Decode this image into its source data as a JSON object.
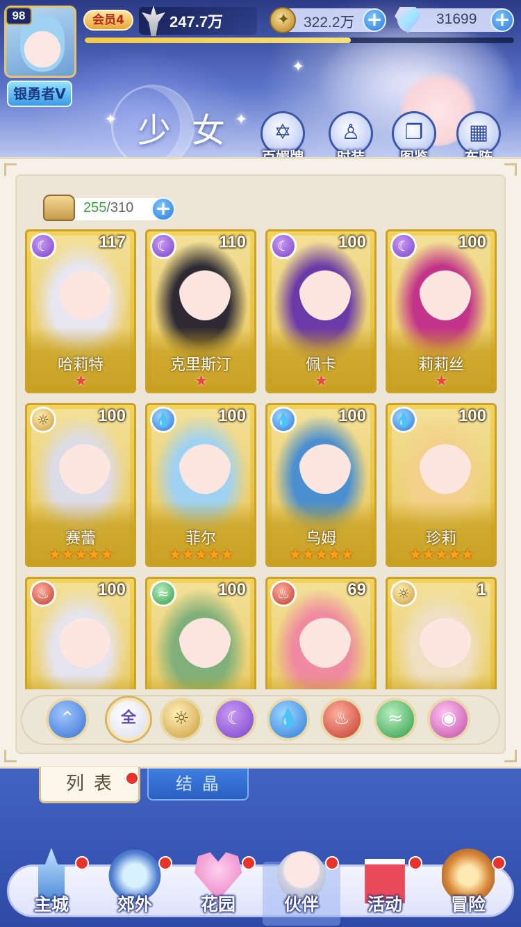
{
  "player": {
    "level": "98",
    "title": "银勇者V",
    "vip": "会员4",
    "power": "247.7万",
    "exp_progress": 0.62
  },
  "resources": [
    {
      "name": "gold-coin",
      "value": "322.2万"
    },
    {
      "name": "diamond",
      "value": "31699"
    }
  ],
  "page": {
    "title": "少女"
  },
  "top_actions": [
    {
      "label": "百媚牌",
      "icon": "card-icon"
    },
    {
      "label": "时装",
      "icon": "costume-icon"
    },
    {
      "label": "图鉴",
      "icon": "book-icon"
    },
    {
      "label": "布阵",
      "icon": "grid-icon"
    }
  ],
  "collection": {
    "current": "255",
    "max": "/310"
  },
  "elements": {
    "moon": "☾",
    "sun": "☼",
    "water": "💧",
    "fire": "♨",
    "wind": "≈"
  },
  "cards": [
    {
      "name": "哈莉特",
      "level": "117",
      "element": "moon",
      "stars": "★",
      "star_type": "red",
      "hair": "#e8e6f2"
    },
    {
      "name": "克里斯汀",
      "level": "110",
      "element": "moon",
      "stars": "★",
      "star_type": "red",
      "hair": "#2d2a34"
    },
    {
      "name": "佩卡",
      "level": "100",
      "element": "moon",
      "stars": "★",
      "star_type": "red",
      "hair": "#6a3aa8"
    },
    {
      "name": "莉莉丝",
      "level": "100",
      "element": "moon",
      "stars": "★",
      "star_type": "red",
      "hair": "#c2348a"
    },
    {
      "name": "赛蕾",
      "level": "100",
      "element": "sun",
      "stars": "★★★★★",
      "star_type": "gold",
      "hair": "#dcdce8"
    },
    {
      "name": "菲尔",
      "level": "100",
      "element": "water",
      "stars": "★★★★★",
      "star_type": "gold",
      "hair": "#9fd2f2"
    },
    {
      "name": "乌姆",
      "level": "100",
      "element": "water",
      "stars": "★★★★★",
      "star_type": "gold",
      "hair": "#4a8fd0"
    },
    {
      "name": "珍莉",
      "level": "100",
      "element": "water",
      "stars": "★★★★★",
      "star_type": "gold",
      "hair": "#f2d28a"
    },
    {
      "name": "",
      "level": "100",
      "element": "fire",
      "stars": "",
      "star_type": "gold",
      "hair": "#e6e4ee"
    },
    {
      "name": "",
      "level": "100",
      "element": "wind",
      "stars": "",
      "star_type": "gold",
      "hair": "#7fb07a"
    },
    {
      "name": "",
      "level": "69",
      "element": "fire",
      "stars": "",
      "star_type": "gold",
      "hair": "#ef8aa0"
    },
    {
      "name": "",
      "level": "1",
      "element": "sun",
      "stars": "",
      "star_type": "gold",
      "hair": "#efe0c4"
    }
  ],
  "filters": {
    "all_label": "全",
    "selected": "全"
  },
  "tabs": {
    "list": "列表",
    "crystal": "结晶"
  },
  "nav": [
    {
      "label": "主城",
      "icon": "castle-icon",
      "dot": true
    },
    {
      "label": "郊外",
      "icon": "portal-icon",
      "dot": true
    },
    {
      "label": "花园",
      "icon": "heart-icon",
      "dot": true
    },
    {
      "label": "伙伴",
      "icon": "partner-icon",
      "dot": true,
      "active": true
    },
    {
      "label": "活动",
      "icon": "gift-icon",
      "dot": true
    },
    {
      "label": "冒险",
      "icon": "compass-icon",
      "dot": true
    }
  ],
  "colors": {
    "accent_blue": "#2d7ad9",
    "card_gold": "#e0b634",
    "red_dot": "#e8332a"
  }
}
